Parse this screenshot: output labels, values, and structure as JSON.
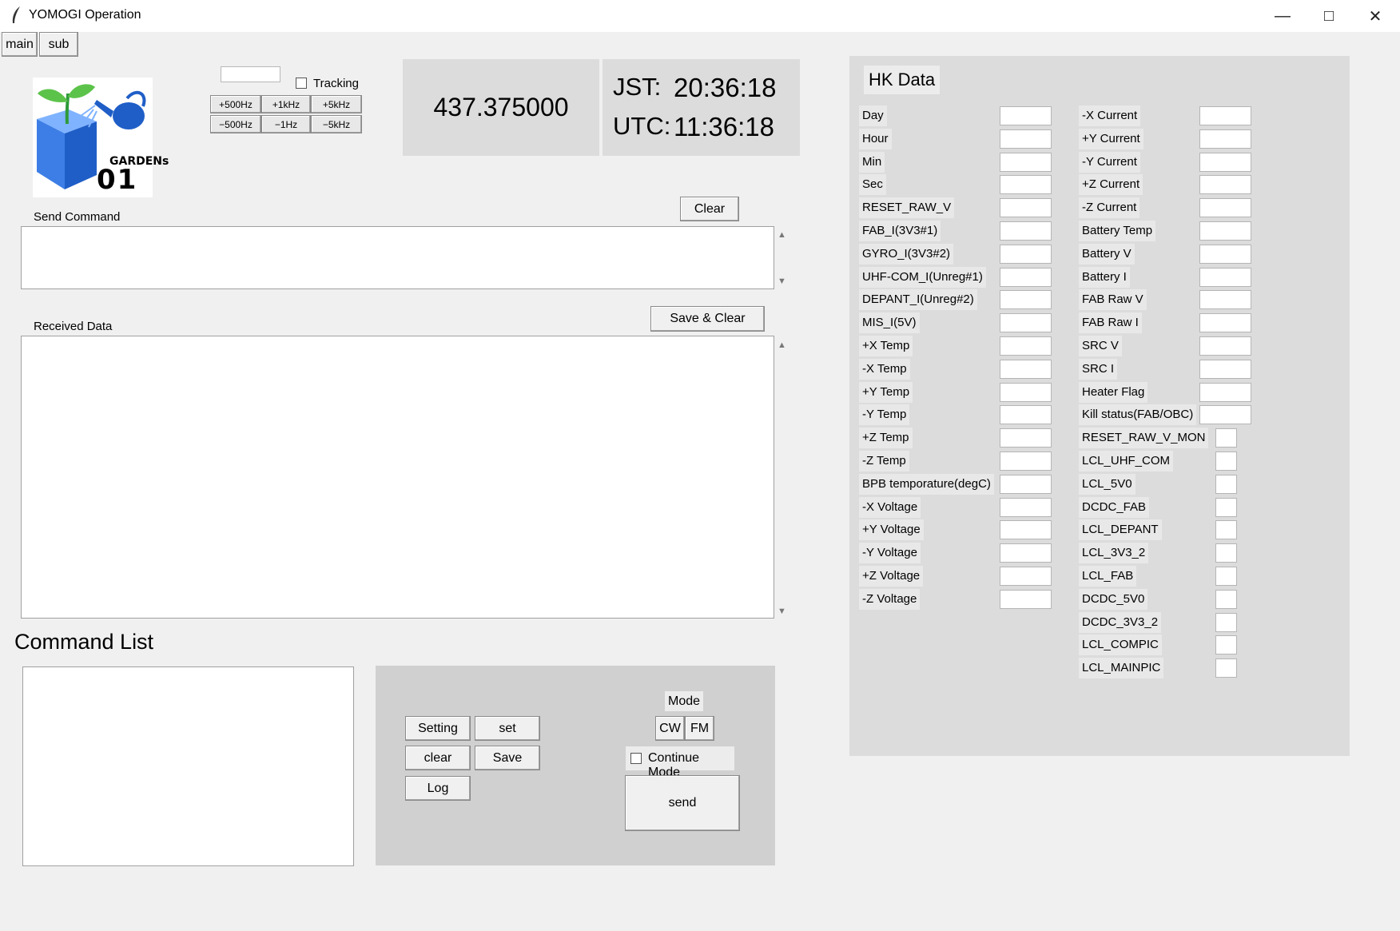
{
  "window": {
    "title": "YOMOGI Operation",
    "minimize_glyph": "—",
    "maximize_glyph": "□",
    "close_glyph": "✕"
  },
  "tabs": [
    {
      "label": "main"
    },
    {
      "label": "sub"
    }
  ],
  "logo": {
    "text_line1": "GARDENs",
    "text_line2": "01"
  },
  "frequency": {
    "input_value": "",
    "tracking_label": "Tracking",
    "tracking_checked": false,
    "buttons_row1": [
      "+500Hz",
      "+1kHz",
      "+5kHz"
    ],
    "buttons_row2": [
      "−500Hz",
      "−1Hz",
      "−5kHz"
    ],
    "display": "437.375000"
  },
  "clock": {
    "jst_label": "JST:",
    "jst_time": "20:36:18",
    "utc_label": "UTC:",
    "utc_time": "11:36:18"
  },
  "send_command": {
    "label": "Send Command",
    "clear_label": "Clear",
    "value": ""
  },
  "received": {
    "label": "Received Data",
    "save_clear_label": "Save & Clear",
    "value": ""
  },
  "command_list": {
    "title": "Command List"
  },
  "controls": {
    "setting_label": "Setting",
    "set_label": "set",
    "clear_label": "clear",
    "save_label": "Save",
    "log_label": "Log",
    "mode_label": "Mode",
    "cw_label": "CW",
    "fm_label": "FM",
    "continue_label": "Continue Mode",
    "continue_checked": false,
    "send_label": "send"
  },
  "hk": {
    "title": "HK Data",
    "left": [
      {
        "label": "Day",
        "value": ""
      },
      {
        "label": "Hour",
        "value": ""
      },
      {
        "label": "Min",
        "value": ""
      },
      {
        "label": "Sec",
        "value": ""
      },
      {
        "label": "RESET_RAW_V",
        "value": ""
      },
      {
        "label": "FAB_I(3V3#1)",
        "value": ""
      },
      {
        "label": "GYRO_I(3V3#2)",
        "value": ""
      },
      {
        "label": "UHF-COM_I(Unreg#1)",
        "value": ""
      },
      {
        "label": "DEPANT_I(Unreg#2)",
        "value": ""
      },
      {
        "label": "MIS_I(5V)",
        "value": ""
      },
      {
        "label": "+X Temp",
        "value": ""
      },
      {
        "label": "-X Temp",
        "value": ""
      },
      {
        "label": "+Y Temp",
        "value": ""
      },
      {
        "label": "-Y Temp",
        "value": ""
      },
      {
        "label": "+Z Temp",
        "value": ""
      },
      {
        "label": "-Z Temp",
        "value": ""
      },
      {
        "label": "BPB temporature(degC)",
        "value": ""
      },
      {
        "label": "-X Voltage",
        "value": ""
      },
      {
        "label": "+Y Voltage",
        "value": ""
      },
      {
        "label": "-Y Voltage",
        "value": ""
      },
      {
        "label": "+Z Voltage",
        "value": ""
      },
      {
        "label": "-Z Voltage",
        "value": ""
      }
    ],
    "right": [
      {
        "label": "-X Current",
        "value": ""
      },
      {
        "label": "+Y Current",
        "value": ""
      },
      {
        "label": "-Y Current",
        "value": ""
      },
      {
        "label": "+Z Current",
        "value": ""
      },
      {
        "label": "-Z Current",
        "value": ""
      },
      {
        "label": "Battery Temp",
        "value": ""
      },
      {
        "label": "Battery V",
        "value": ""
      },
      {
        "label": "Battery I",
        "value": ""
      },
      {
        "label": "FAB Raw V",
        "value": ""
      },
      {
        "label": "FAB Raw I",
        "value": ""
      },
      {
        "label": "SRC V",
        "value": ""
      },
      {
        "label": "SRC I",
        "value": ""
      },
      {
        "label": "Heater Flag",
        "value": ""
      },
      {
        "label": "Kill status(FAB/OBC)",
        "value": ""
      },
      {
        "label": "RESET_RAW_V_MON",
        "value": ""
      },
      {
        "label": "LCL_UHF_COM",
        "value": ""
      },
      {
        "label": "LCL_5V0",
        "value": ""
      },
      {
        "label": "DCDC_FAB",
        "value": ""
      },
      {
        "label": "LCL_DEPANT",
        "value": ""
      },
      {
        "label": "LCL_3V3_2",
        "value": ""
      },
      {
        "label": "LCL_FAB",
        "value": ""
      },
      {
        "label": "DCDC_5V0",
        "value": ""
      },
      {
        "label": "DCDC_3V3_2",
        "value": ""
      },
      {
        "label": "LCL_COMPIC",
        "value": ""
      },
      {
        "label": "LCL_MAINPIC",
        "value": ""
      }
    ]
  },
  "scroll_up_glyph": "▲",
  "scroll_down_glyph": "▼"
}
